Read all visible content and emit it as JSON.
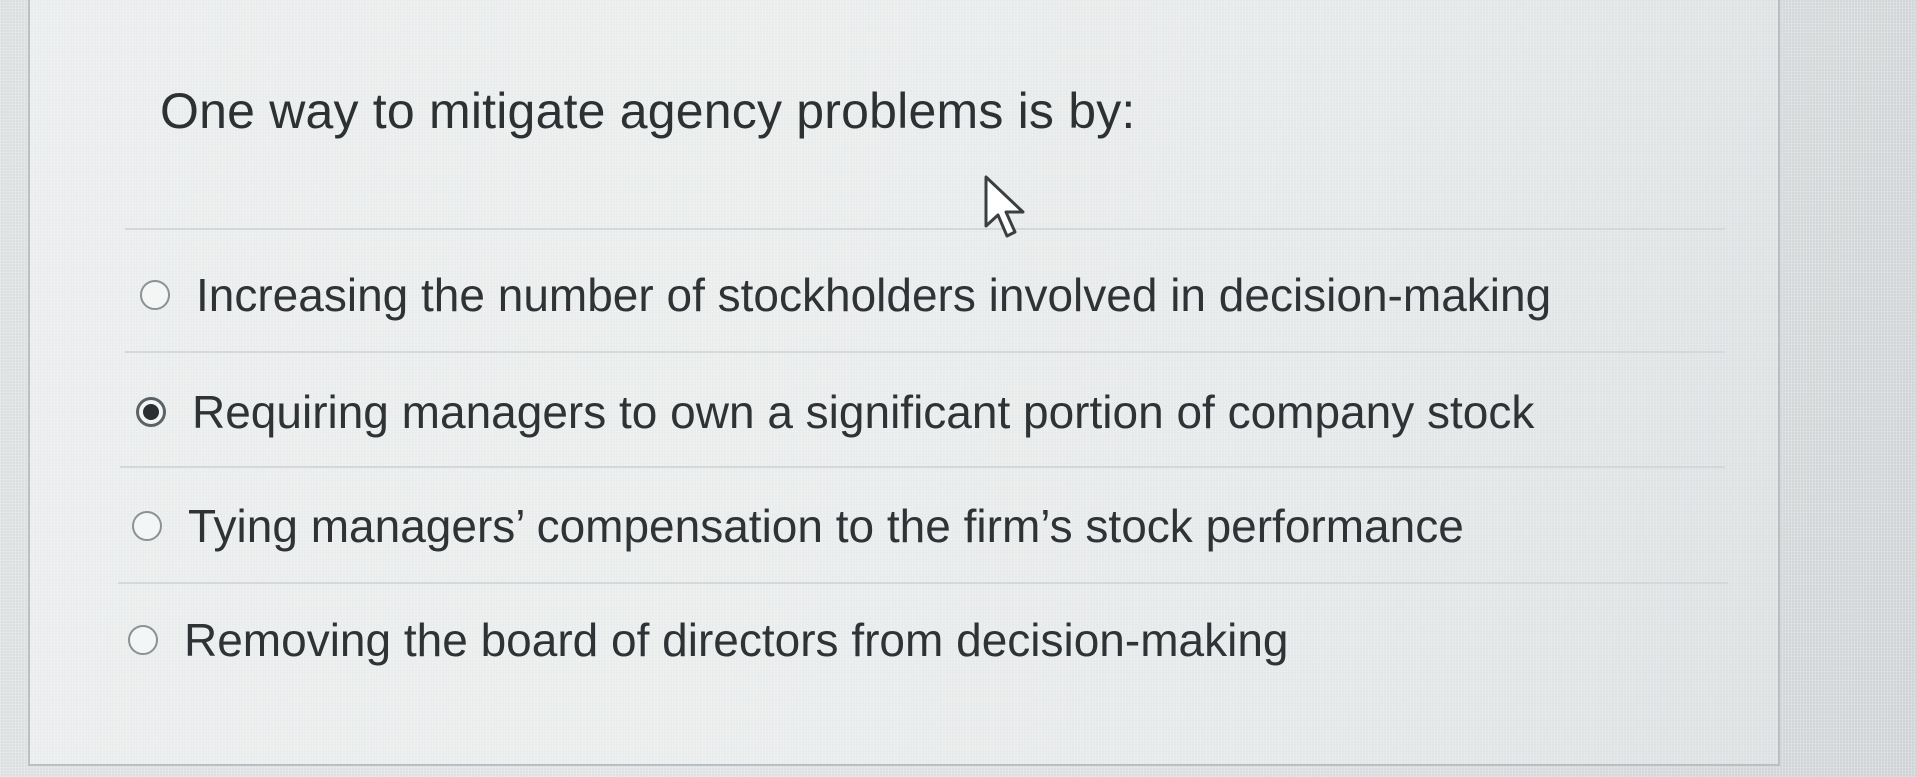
{
  "question": {
    "text": "One way to mitigate agency problems is by:"
  },
  "options": [
    {
      "label": "Increasing the number of stockholders involved in decision-making",
      "selected": false
    },
    {
      "label": "Requiring managers to own a significant portion of company stock",
      "selected": true
    },
    {
      "label": "Tying managers’ compensation to the firm’s stock performance",
      "selected": false
    },
    {
      "label": "Removing the board of directors from decision-making",
      "selected": false
    }
  ],
  "icons": {
    "cursor": "mouse-pointer-icon",
    "radio_unselected": "radio-unselected-icon",
    "radio_selected": "radio-selected-icon"
  },
  "colors": {
    "text": "#2f3336",
    "radio_border": "#8b9296",
    "radio_fill_selected": "#2b2f32",
    "panel_border": "#b9bfc2",
    "background": "#e6e9ea"
  }
}
